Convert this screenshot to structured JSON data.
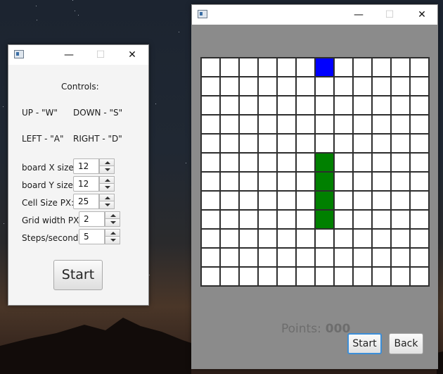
{
  "colors": {
    "snake_head": "#0000ff",
    "snake_body": "#008000",
    "cell_empty": "#ffffff",
    "grid_line": "#2e2e2e",
    "game_background": "#8b8b8b"
  },
  "controls_window": {
    "title_buttons": {
      "minimize": "—",
      "maximize": "☐",
      "close": "✕"
    },
    "heading": "Controls:",
    "up_hint": "UP - \"W\"",
    "down_hint": "DOWN - \"S\"",
    "left_hint": "LEFT - \"A\"",
    "right_hint": "RIGHT - \"D\"",
    "fields": [
      {
        "label": "board X size:",
        "value": "12"
      },
      {
        "label": "board Y size:",
        "value": "12"
      },
      {
        "label": "Cell Size PX:",
        "value": "25"
      },
      {
        "label": "Grid width PX:",
        "value": "2"
      },
      {
        "label": "Steps/second:",
        "value": "5"
      }
    ],
    "start_button": "Start"
  },
  "game_window": {
    "title_buttons": {
      "minimize": "—",
      "maximize": "☐",
      "close": "✕"
    },
    "board": {
      "columns": 12,
      "rows": 12,
      "food": {
        "col": 6,
        "row": 0
      },
      "snake": [
        {
          "col": 6,
          "row": 5
        },
        {
          "col": 6,
          "row": 6
        },
        {
          "col": 6,
          "row": 7
        },
        {
          "col": 6,
          "row": 8
        }
      ]
    },
    "points_label": "Points:",
    "points_value": "000",
    "start_button": "Start",
    "back_button": "Back"
  }
}
